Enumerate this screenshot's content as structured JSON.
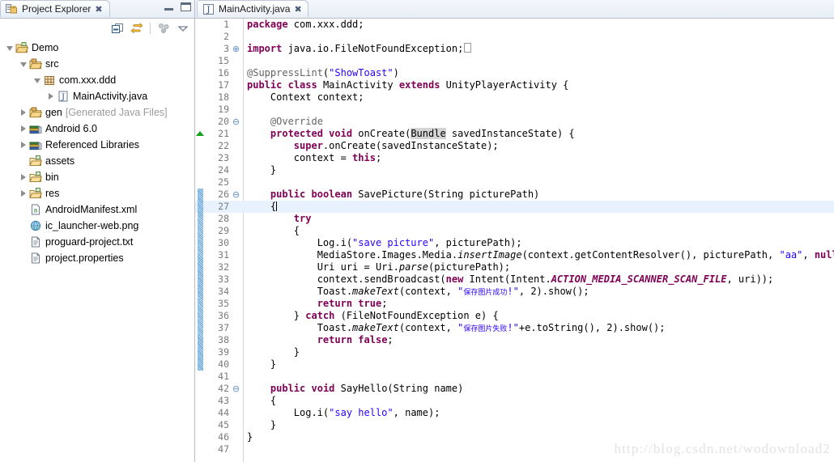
{
  "explorer": {
    "tab_title": "Project Explorer",
    "close_label": "✖",
    "window_buttons": {
      "minimize": "minimize-view",
      "maximize": "maximize-view"
    },
    "toolbar": [
      {
        "name": "collapse-all-icon",
        "tooltip": "Collapse All"
      },
      {
        "name": "link-with-editor-icon",
        "tooltip": "Link with Editor"
      },
      {
        "name": "view-menu-icon",
        "tooltip": "View Menu"
      },
      {
        "name": "chevron-down-icon",
        "tooltip": "View Menu"
      }
    ],
    "tree": [
      {
        "label": "Demo",
        "sub": "",
        "indent": 0,
        "state": "expanded",
        "icon": "project-icon"
      },
      {
        "label": "src",
        "sub": "",
        "indent": 1,
        "state": "expanded",
        "icon": "source-folder-icon"
      },
      {
        "label": "com.xxx.ddd",
        "sub": "",
        "indent": 2,
        "state": "expanded",
        "icon": "package-icon"
      },
      {
        "label": "MainActivity.java",
        "sub": "",
        "indent": 3,
        "state": "collapsed",
        "icon": "java-file-icon"
      },
      {
        "label": "gen",
        "sub": "[Generated Java Files]",
        "indent": 1,
        "state": "collapsed",
        "icon": "source-folder-icon"
      },
      {
        "label": "Android 6.0",
        "sub": "",
        "indent": 1,
        "state": "collapsed",
        "icon": "library-icon"
      },
      {
        "label": "Referenced Libraries",
        "sub": "",
        "indent": 1,
        "state": "collapsed",
        "icon": "library-icon"
      },
      {
        "label": "assets",
        "sub": "",
        "indent": 1,
        "state": "none",
        "icon": "folder-icon"
      },
      {
        "label": "bin",
        "sub": "",
        "indent": 1,
        "state": "collapsed",
        "icon": "folder-icon"
      },
      {
        "label": "res",
        "sub": "",
        "indent": 1,
        "state": "collapsed",
        "icon": "folder-icon"
      },
      {
        "label": "AndroidManifest.xml",
        "sub": "",
        "indent": 1,
        "state": "none",
        "icon": "xml-file-icon"
      },
      {
        "label": "ic_launcher-web.png",
        "sub": "",
        "indent": 1,
        "state": "none",
        "icon": "image-file-icon"
      },
      {
        "label": "proguard-project.txt",
        "sub": "",
        "indent": 1,
        "state": "none",
        "icon": "text-file-icon"
      },
      {
        "label": "project.properties",
        "sub": "",
        "indent": 1,
        "state": "none",
        "icon": "text-file-icon"
      }
    ]
  },
  "editor": {
    "tab_title": "MainActivity.java",
    "close_label": "✖",
    "current_line": 27,
    "marker_line": 21,
    "change_bar_start": 26,
    "change_bar_end": 40,
    "lines": [
      {
        "n": 1,
        "fold": "",
        "text": "package com.xxx.ddd;"
      },
      {
        "n": 2,
        "fold": "",
        "text": ""
      },
      {
        "n": 3,
        "fold": "+",
        "text": "import java.io.FileNotFoundException;"
      },
      {
        "n": 15,
        "fold": "",
        "text": ""
      },
      {
        "n": 16,
        "fold": "",
        "text": "@SuppressLint(\"ShowToast\")"
      },
      {
        "n": 17,
        "fold": "",
        "text": "public class MainActivity extends UnityPlayerActivity {"
      },
      {
        "n": 18,
        "fold": "",
        "text": "    Context context;"
      },
      {
        "n": 19,
        "fold": "",
        "text": ""
      },
      {
        "n": 20,
        "fold": "-",
        "text": "    @Override"
      },
      {
        "n": 21,
        "fold": "",
        "text": "    protected void onCreate(Bundle savedInstanceState) {"
      },
      {
        "n": 22,
        "fold": "",
        "text": "        super.onCreate(savedInstanceState);"
      },
      {
        "n": 23,
        "fold": "",
        "text": "        context = this;"
      },
      {
        "n": 24,
        "fold": "",
        "text": "    }"
      },
      {
        "n": 25,
        "fold": "",
        "text": ""
      },
      {
        "n": 26,
        "fold": "-",
        "text": "    public boolean SavePicture(String picturePath)"
      },
      {
        "n": 27,
        "fold": "",
        "text": "    {"
      },
      {
        "n": 28,
        "fold": "",
        "text": "        try"
      },
      {
        "n": 29,
        "fold": "",
        "text": "        {"
      },
      {
        "n": 30,
        "fold": "",
        "text": "            Log.i(\"save picture\", picturePath);"
      },
      {
        "n": 31,
        "fold": "",
        "text": "            MediaStore.Images.Media.insertImage(context.getContentResolver(), picturePath, \"aa\", null);"
      },
      {
        "n": 32,
        "fold": "",
        "text": "            Uri uri = Uri.parse(picturePath);"
      },
      {
        "n": 33,
        "fold": "",
        "text": "            context.sendBroadcast(new Intent(Intent.ACTION_MEDIA_SCANNER_SCAN_FILE, uri));"
      },
      {
        "n": 34,
        "fold": "",
        "text": "            Toast.makeText(context, \"保存图片成功!\", 2).show();"
      },
      {
        "n": 35,
        "fold": "",
        "text": "            return true;"
      },
      {
        "n": 36,
        "fold": "",
        "text": "        } catch (FileNotFoundException e) {"
      },
      {
        "n": 37,
        "fold": "",
        "text": "            Toast.makeText(context, \"保存图片失败!\"+e.toString(), 2).show();"
      },
      {
        "n": 38,
        "fold": "",
        "text": "            return false;"
      },
      {
        "n": 39,
        "fold": "",
        "text": "        }"
      },
      {
        "n": 40,
        "fold": "",
        "text": "    }"
      },
      {
        "n": 41,
        "fold": "",
        "text": ""
      },
      {
        "n": 42,
        "fold": "-",
        "text": "    public void SayHello(String name)"
      },
      {
        "n": 43,
        "fold": "",
        "text": "    {"
      },
      {
        "n": 44,
        "fold": "",
        "text": "        Log.i(\"say hello\", name);"
      },
      {
        "n": 45,
        "fold": "",
        "text": "    }"
      },
      {
        "n": 46,
        "fold": "",
        "text": "}"
      },
      {
        "n": 47,
        "fold": "",
        "text": ""
      }
    ]
  },
  "watermark": {
    "text": "http://blog.csdn.net/wodownload2"
  },
  "colors": {
    "keyword": "#7F0055",
    "string": "#2A00FF",
    "line_number": "#7A7A7A",
    "current_line_bg": "#E8F2FE",
    "change_bar": "#5A9FD4",
    "marker_green": "#19A019"
  }
}
